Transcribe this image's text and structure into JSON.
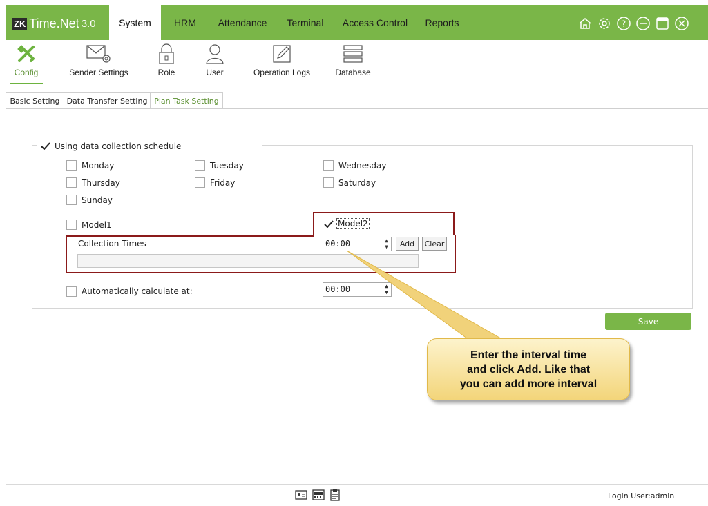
{
  "app": {
    "logo_mark": "ZK",
    "name": "Time.Net",
    "version": "3.0"
  },
  "nav": [
    {
      "label": "System",
      "active": true
    },
    {
      "label": "HRM"
    },
    {
      "label": "Attendance"
    },
    {
      "label": "Terminal"
    },
    {
      "label": "Access Control"
    },
    {
      "label": "Reports"
    }
  ],
  "window_icons": [
    "home-icon",
    "gear-icon",
    "help-icon",
    "minimize-icon",
    "maximize-icon",
    "close-icon"
  ],
  "toolbar": [
    {
      "label": "Config",
      "icon": "tools-icon",
      "active": true
    },
    {
      "label": "Sender Settings",
      "icon": "mail-settings-icon"
    },
    {
      "label": "Role",
      "icon": "lock-icon"
    },
    {
      "label": "User",
      "icon": "user-icon"
    },
    {
      "label": "Operation Logs",
      "icon": "edit-log-icon"
    },
    {
      "label": "Database",
      "icon": "database-icon"
    }
  ],
  "tabs": [
    {
      "label": "Basic Setting"
    },
    {
      "label": "Data Transfer Setting"
    },
    {
      "label": "Plan Task Setting",
      "active": true
    }
  ],
  "schedule": {
    "enable_label": "Using data collection schedule",
    "enabled": true,
    "days": [
      {
        "label": "Monday",
        "checked": false
      },
      {
        "label": "Tuesday",
        "checked": false
      },
      {
        "label": "Wednesday",
        "checked": false
      },
      {
        "label": "Thursday",
        "checked": false
      },
      {
        "label": "Friday",
        "checked": false
      },
      {
        "label": "Saturday",
        "checked": false
      },
      {
        "label": "Sunday",
        "checked": false
      }
    ],
    "model1": {
      "label": "Model1",
      "checked": false
    },
    "model2": {
      "label": "Model2",
      "checked": true
    },
    "collection_times_label": "Collection Times",
    "collection_time_value": "00:00",
    "add_label": "Add",
    "clear_label": "Clear",
    "auto_calc_label": "Automatically calculate at:",
    "auto_calc_checked": false,
    "auto_calc_time": "00:00"
  },
  "save_label": "Save",
  "callout": {
    "line1": "Enter the  interval time",
    "line2": "and click Add. Like that",
    "line3": "you can add more interval"
  },
  "status": {
    "login": "Login User:admin"
  },
  "colors": {
    "brand_green": "#7ab648",
    "annotation_red": "#8b1a1a",
    "callout_yellow": "#f3d57a"
  }
}
